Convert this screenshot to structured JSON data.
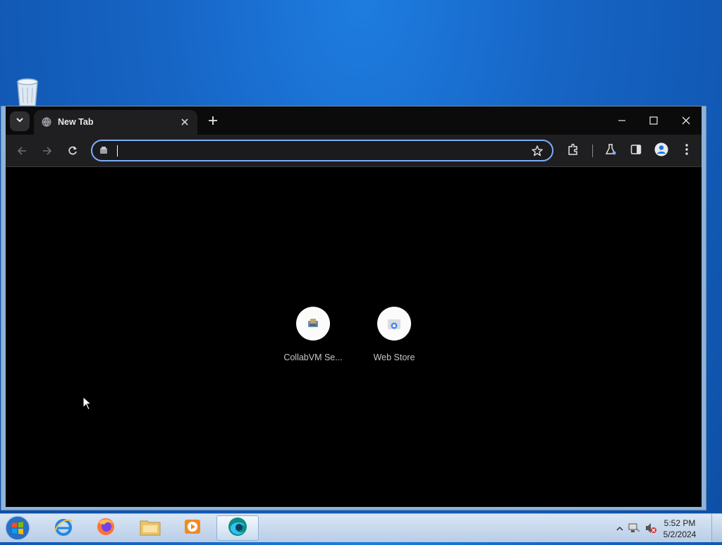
{
  "desktop": {
    "icons": [
      "recycle-bin-icon"
    ]
  },
  "browser": {
    "tab": {
      "title": "New Tab"
    },
    "omnibox": {
      "value": "",
      "placeholder": ""
    },
    "accent": "#7cacf8",
    "shortcuts": [
      {
        "label": "CollabVM Se..."
      },
      {
        "label": "Web Store"
      }
    ]
  },
  "taskbar": {
    "clock": {
      "time": "5:52 PM",
      "date": "5/2/2024"
    }
  }
}
